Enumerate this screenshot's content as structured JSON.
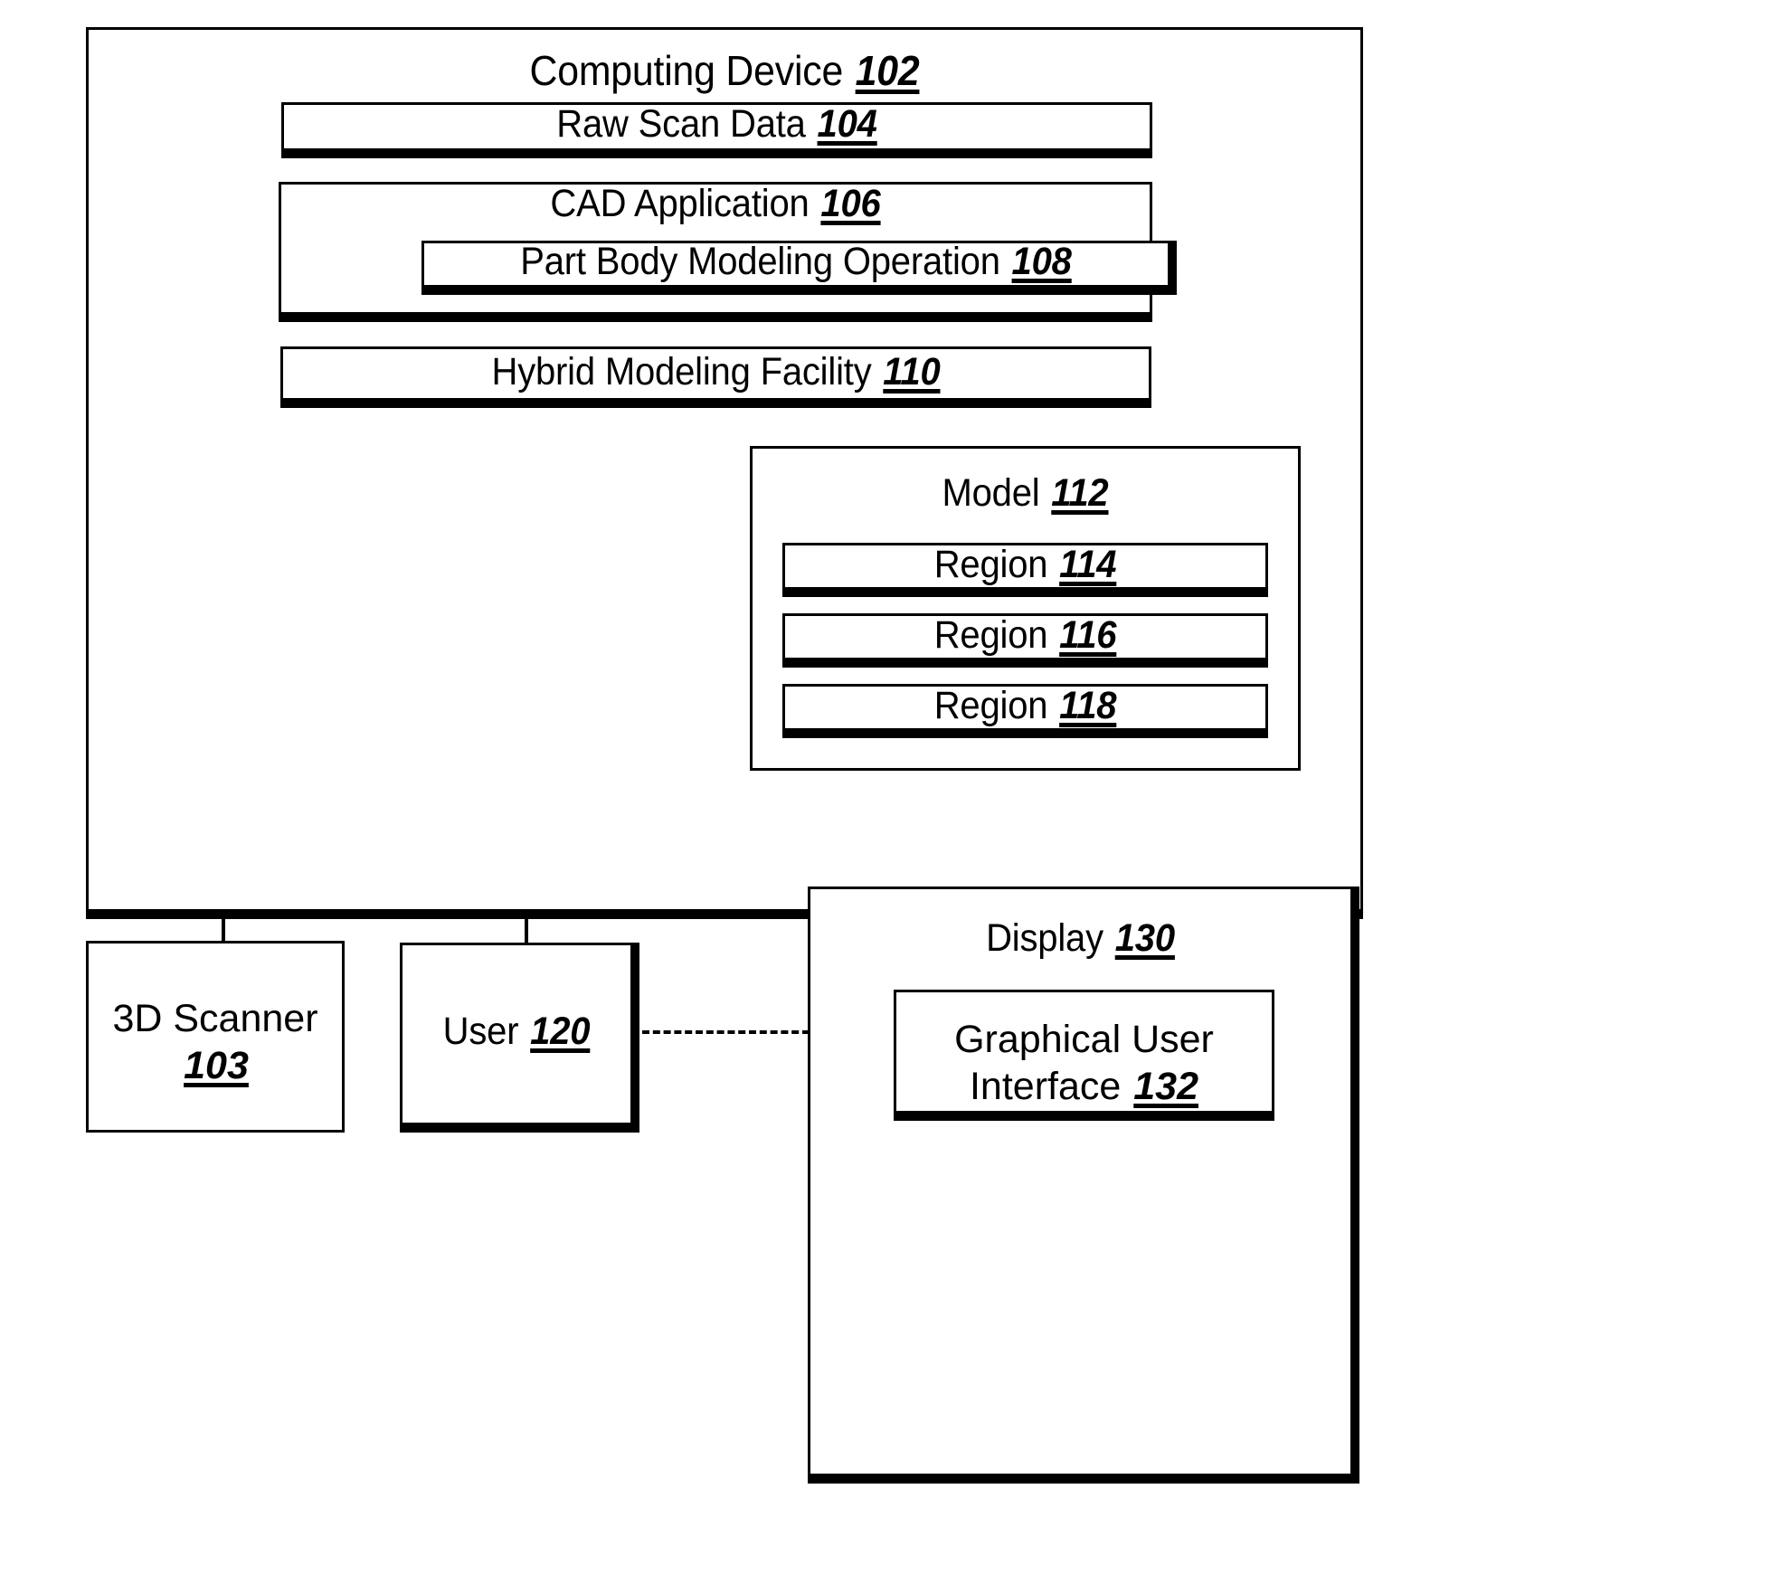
{
  "figure": {
    "type": "block-diagram",
    "background_color": "#ffffff",
    "line_color": "#000000"
  },
  "computing_device": {
    "title": "Computing Device",
    "ref": "102",
    "raw_scan_data": {
      "title": "Raw Scan Data",
      "ref": "104"
    },
    "cad_application": {
      "title": "CAD Application",
      "ref": "106",
      "part_body_modeling_operation": {
        "title": "Part Body Modeling Operation",
        "ref": "108"
      }
    },
    "hybrid_modeling_facility": {
      "title": "Hybrid Modeling Facility",
      "ref": "110"
    },
    "model": {
      "title": "Model",
      "ref": "112",
      "regions": [
        {
          "title": "Region",
          "ref": "114"
        },
        {
          "title": "Region",
          "ref": "116"
        },
        {
          "title": "Region",
          "ref": "118"
        }
      ]
    }
  },
  "scanner": {
    "title": "3D Scanner",
    "ref": "103"
  },
  "user": {
    "title": "User",
    "ref": "120"
  },
  "display": {
    "title": "Display",
    "ref": "130",
    "gui": {
      "line1": "Graphical User",
      "line2": "Interface ",
      "ref": "132"
    }
  },
  "connectors": [
    {
      "name": "computing-device-to-scanner",
      "style": "solid"
    },
    {
      "name": "computing-device-to-user",
      "style": "solid"
    },
    {
      "name": "computing-device-to-display",
      "style": "solid"
    },
    {
      "name": "user-to-display",
      "style": "dashed"
    }
  ]
}
